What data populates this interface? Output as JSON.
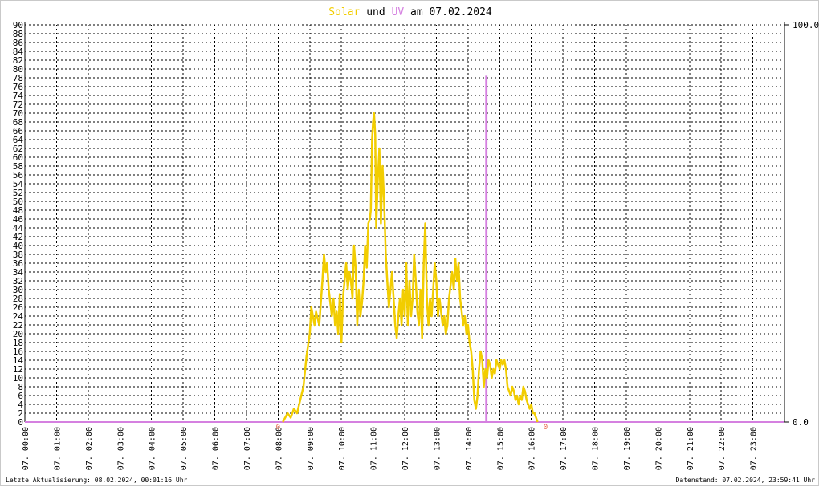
{
  "title": {
    "solar_word": "Solar",
    "und_word": "und",
    "uv_word": "UV",
    "date_text": "am 07.02.2024",
    "solar_color": "#f2cd00",
    "uv_color": "#d580e0"
  },
  "footer": {
    "left": "Letzte Aktualisierung: 08.02.2024, 00:01:16 Uhr",
    "right": "Datenstand: 07.02.2024, 23:59:41 Uhr"
  },
  "chart_data": {
    "type": "line",
    "x_range_hours": [
      0,
      24
    ],
    "ylim": [
      0,
      90
    ],
    "y_ticks": [
      0,
      2,
      4,
      6,
      8,
      10,
      12,
      14,
      16,
      18,
      20,
      22,
      24,
      26,
      28,
      30,
      32,
      34,
      36,
      38,
      40,
      42,
      44,
      46,
      48,
      50,
      52,
      54,
      56,
      58,
      60,
      62,
      64,
      66,
      68,
      70,
      72,
      74,
      76,
      78,
      80,
      82,
      84,
      86,
      88,
      90
    ],
    "y2lim": [
      0,
      100
    ],
    "y2_tick_labels": [
      "0.0",
      "100.0"
    ],
    "x_tick_labels": [
      "07. 00:00",
      "07. 01:00",
      "07. 02:00",
      "07. 03:00",
      "07. 04:00",
      "07. 05:00",
      "07. 06:00",
      "07. 07:00",
      "07. 08:00",
      "07. 09:00",
      "07. 10:00",
      "07. 11:00",
      "07. 12:00",
      "07. 13:00",
      "07. 14:00",
      "07. 15:00",
      "07. 16:00",
      "07. 17:00",
      "07. 18:00",
      "07. 19:00",
      "07. 20:00",
      "07. 21:00",
      "07. 22:00",
      "07. 23:00"
    ],
    "grid": true,
    "series": [
      {
        "name": "Solar",
        "color": "#f2cd00",
        "x_hours": [
          8.15,
          8.3,
          8.4,
          8.5,
          8.6,
          8.7,
          8.8,
          8.9,
          9.0,
          9.05,
          9.1,
          9.15,
          9.2,
          9.3,
          9.4,
          9.45,
          9.5,
          9.55,
          9.6,
          9.7,
          9.75,
          9.8,
          9.85,
          9.9,
          9.95,
          10.0,
          10.05,
          10.1,
          10.15,
          10.2,
          10.25,
          10.3,
          10.35,
          10.4,
          10.45,
          10.5,
          10.55,
          10.6,
          10.65,
          10.7,
          10.75,
          10.8,
          10.85,
          10.9,
          10.93,
          10.97,
          11.0,
          11.03,
          11.07,
          11.1,
          11.15,
          11.2,
          11.25,
          11.3,
          11.35,
          11.4,
          11.45,
          11.5,
          11.55,
          11.6,
          11.65,
          11.7,
          11.75,
          11.8,
          11.85,
          11.9,
          11.95,
          12.0,
          12.05,
          12.1,
          12.15,
          12.2,
          12.25,
          12.3,
          12.35,
          12.4,
          12.45,
          12.5,
          12.55,
          12.6,
          12.65,
          12.7,
          12.75,
          12.8,
          12.85,
          12.9,
          12.95,
          13.0,
          13.05,
          13.1,
          13.15,
          13.2,
          13.25,
          13.3,
          13.35,
          13.4,
          13.45,
          13.5,
          13.55,
          13.6,
          13.65,
          13.7,
          13.75,
          13.8,
          13.85,
          13.9,
          13.95,
          14.0,
          14.05,
          14.1,
          14.15,
          14.2,
          14.25,
          14.3,
          14.35,
          14.4,
          14.45,
          14.5,
          14.55,
          14.6,
          14.65,
          14.7,
          14.75,
          14.8,
          14.85,
          14.9,
          14.95,
          15.0,
          15.05,
          15.1,
          15.15,
          15.2,
          15.25,
          15.3,
          15.35,
          15.4,
          15.45,
          15.5,
          15.55,
          15.6,
          15.65,
          15.7,
          15.75,
          15.8,
          15.85,
          15.9,
          15.95,
          16.0,
          16.05,
          16.1,
          16.15,
          16.2,
          16.25,
          16.3,
          16.35,
          16.4,
          16.45,
          16.5,
          16.55,
          16.6,
          16.65,
          16.7,
          16.75,
          16.8,
          16.85,
          16.9
        ],
        "values": [
          0,
          2,
          1,
          3,
          2,
          5,
          8,
          15,
          20,
          26,
          24,
          22,
          25,
          22,
          32,
          38,
          34,
          36,
          30,
          24,
          28,
          22,
          25,
          20,
          29,
          18,
          28,
          32,
          36,
          30,
          34,
          32,
          28,
          40,
          35,
          22,
          30,
          24,
          27,
          32,
          40,
          35,
          45,
          46,
          48,
          64,
          68,
          70,
          65,
          44,
          55,
          62,
          45,
          58,
          50,
          38,
          32,
          26,
          30,
          34,
          28,
          22,
          19,
          24,
          28,
          22,
          30,
          24,
          36,
          22,
          32,
          24,
          28,
          38,
          32,
          25,
          22,
          30,
          19,
          36,
          45,
          28,
          22,
          28,
          24,
          30,
          36,
          32,
          24,
          28,
          25,
          22,
          24,
          20,
          22,
          28,
          31,
          34,
          30,
          37,
          32,
          36,
          28,
          25,
          22,
          24,
          20,
          22,
          18,
          16,
          12,
          5,
          3,
          6,
          12,
          16,
          14,
          8,
          12,
          10,
          14,
          13,
          10,
          12,
          11,
          14,
          13,
          12,
          14,
          13,
          14,
          12,
          8,
          7,
          6,
          8,
          7,
          5,
          6,
          4,
          6,
          5,
          8,
          7,
          5,
          4,
          3,
          4,
          2,
          2,
          1,
          0
        ],
        "values_end_hours": [
          16.9,
          24
        ]
      },
      {
        "name": "UV",
        "color": "#d580e0",
        "x_hours": [
          0,
          14.57,
          14.57,
          14.59,
          14.59,
          24
        ],
        "values_percent": [
          0,
          0,
          87,
          87,
          0,
          0
        ]
      }
    ],
    "markers": [
      {
        "text": "0",
        "color": "#e8664a",
        "x_hours": 8.0
      },
      {
        "text": "0",
        "color": "#e8664a",
        "x_hours": 16.45
      }
    ]
  }
}
